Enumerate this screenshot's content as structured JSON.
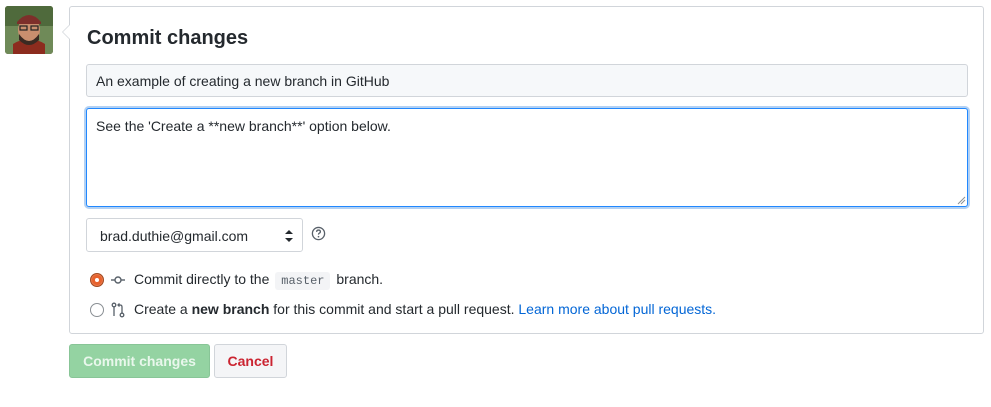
{
  "commit": {
    "heading": "Commit changes",
    "summary_value": "An example of creating a new branch in GitHub",
    "description_value": "See the 'Create a **new branch**' option below.",
    "email_selected": "brad.duthie@gmail.com",
    "options": [
      {
        "checked": true,
        "icon": "git-commit-icon",
        "text_before": "Commit directly to the",
        "branch": "master",
        "text_after": "branch."
      },
      {
        "checked": false,
        "icon": "git-pull-request-icon",
        "text_before": "Create a",
        "bold": "new branch",
        "text_after": "for this commit and start a pull request.",
        "link": "Learn more about pull requests."
      }
    ],
    "commit_button": "Commit changes",
    "cancel_button": "Cancel"
  },
  "colors": {
    "accent_blue": "#0366d6",
    "radio_orange": "#e7622d",
    "commit_disabled_green": "#94d3a2",
    "cancel_red": "#cb2431"
  }
}
